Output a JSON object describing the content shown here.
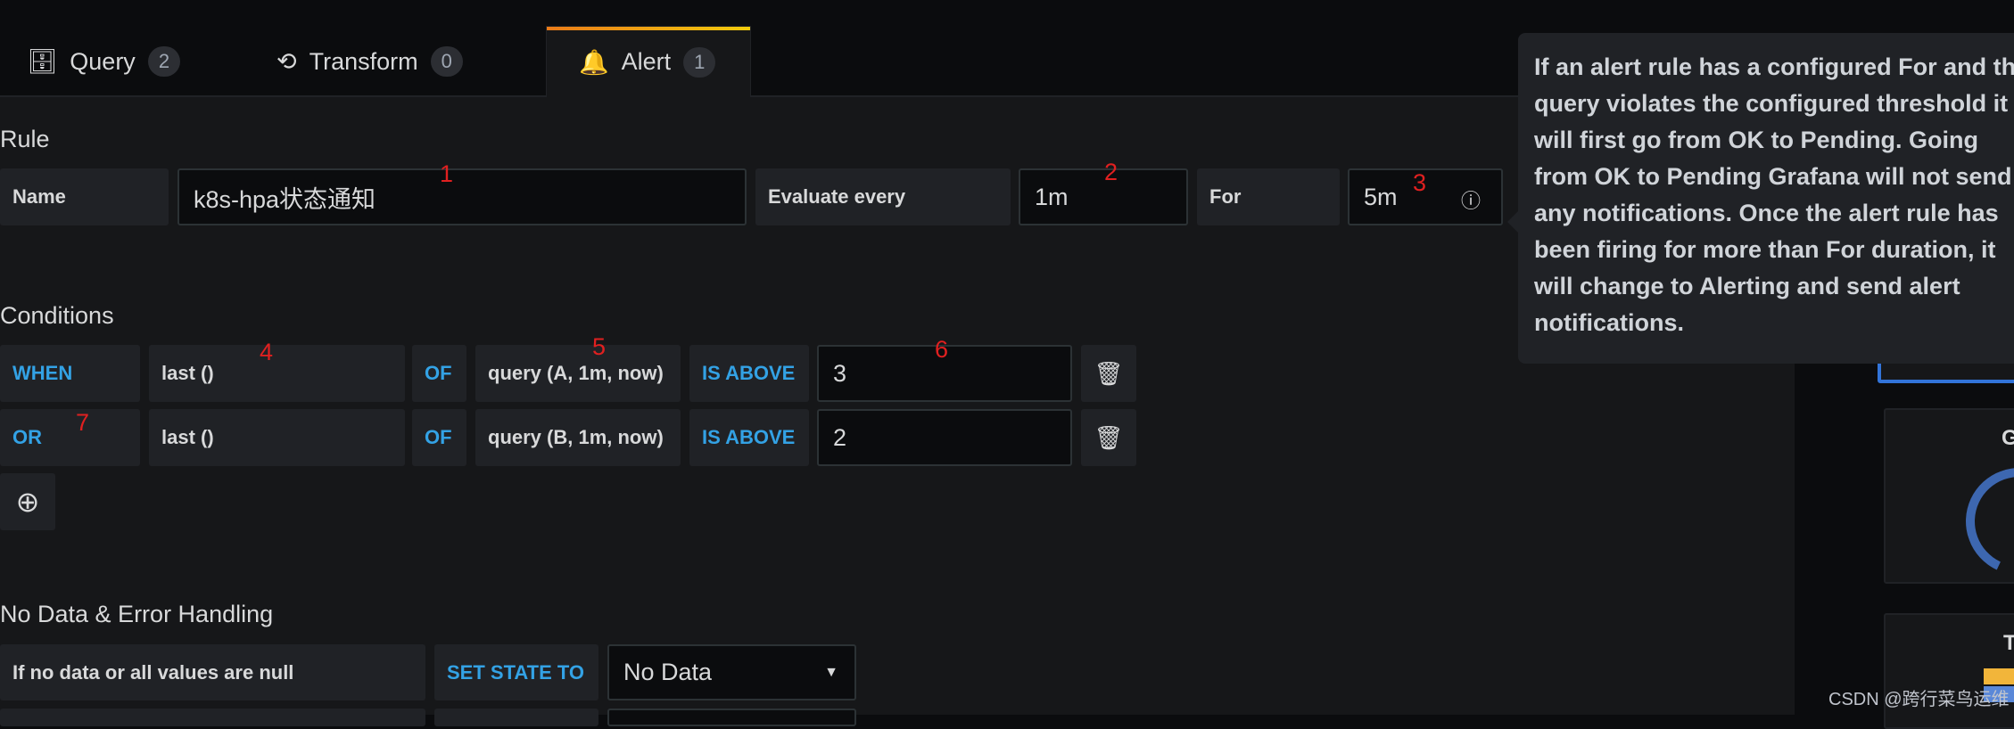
{
  "tabs": [
    {
      "label": "Query",
      "count": "2",
      "icon": "database-icon"
    },
    {
      "label": "Transform",
      "count": "0",
      "icon": "transform-icon"
    },
    {
      "label": "Alert",
      "count": "1",
      "icon": "bell-icon",
      "active": true
    }
  ],
  "rule": {
    "title": "Rule",
    "name_label": "Name",
    "name_value": "k8s-hpa状态通知",
    "evaluate_label": "Evaluate every",
    "evaluate_value": "1m",
    "for_label": "For",
    "for_value": "5m"
  },
  "conditions": {
    "title": "Conditions",
    "rows": [
      {
        "op": "WHEN",
        "reducer": "last ()",
        "of": "OF",
        "query": "query (A, 1m, now)",
        "evaluator": "IS ABOVE",
        "value": "3"
      },
      {
        "op": "OR",
        "reducer": "last ()",
        "of": "OF",
        "query": "query (B, 1m, now)",
        "evaluator": "IS ABOVE",
        "value": "2"
      }
    ]
  },
  "no_data": {
    "title": "No Data & Error Handling",
    "label": "If no data or all values are null",
    "set_state": "SET STATE TO",
    "state_value": "No Data"
  },
  "tooltip": "If an alert rule has a configured For and the query violates the configured threshold it will first go from OK to Pending. Going from OK to Pending Grafana will not send any notifications. Once the alert rule has been firing for more than For duration, it will change to Alerting and send alert notifications.",
  "annotations": [
    "1",
    "2",
    "3",
    "4",
    "5",
    "6",
    "7"
  ],
  "sidebar": {
    "card_title_partial": "G",
    "card2_title_partial": "T"
  },
  "watermark": "CSDN @跨行菜鸟运维",
  "colors": {
    "accent_keyword": "#33a2e5",
    "annotation_red": "#e02020",
    "tab_gradient_start": "#eb7b18",
    "tab_gradient_end": "#f2cc0c"
  }
}
